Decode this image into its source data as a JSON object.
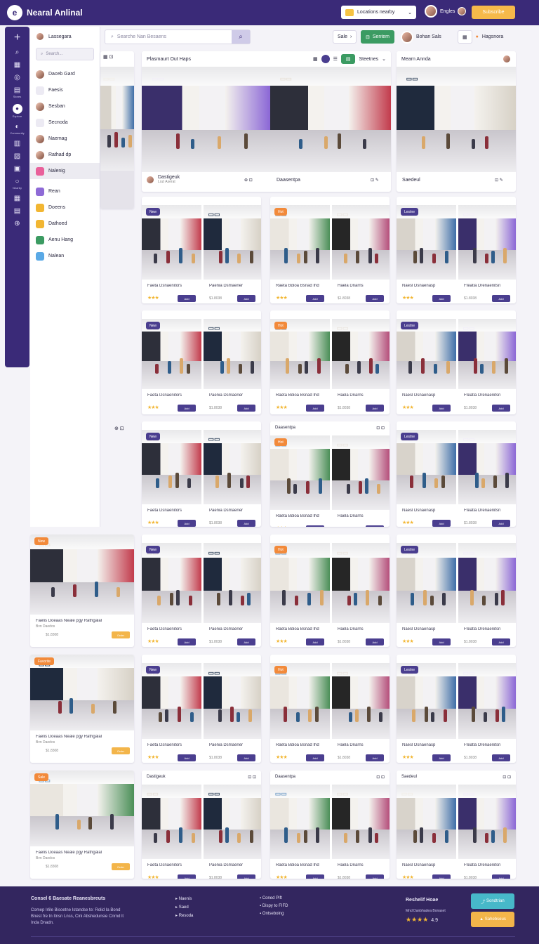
{
  "app": {
    "name": "Nearal Anlinal",
    "logo_glyph": "e"
  },
  "topbar": {
    "location_select": "Locations nearby",
    "user_name": "Engles",
    "cta_label": "Subscribe"
  },
  "rail": {
    "items": [
      {
        "icon": "plus-icon",
        "glyph": "+",
        "caption": ""
      },
      {
        "icon": "search-icon",
        "glyph": "⌕",
        "caption": ""
      },
      {
        "icon": "grid-icon",
        "glyph": "▦",
        "caption": ""
      },
      {
        "icon": "compass-icon",
        "glyph": "◎",
        "caption": ""
      },
      {
        "icon": "store-icon",
        "glyph": "▤",
        "caption": "Stores"
      },
      {
        "icon": "home-icon",
        "glyph": "●",
        "caption": "Explore",
        "active": true
      },
      {
        "icon": "map-icon",
        "glyph": "◐",
        "caption": "Community"
      },
      {
        "icon": "list-icon",
        "glyph": "▥",
        "caption": ""
      },
      {
        "icon": "layers-icon",
        "glyph": "▧",
        "caption": ""
      },
      {
        "icon": "image-icon",
        "glyph": "▣",
        "caption": ""
      },
      {
        "icon": "pin-icon",
        "glyph": "○",
        "caption": "Nearby"
      },
      {
        "icon": "calendar-icon",
        "glyph": "▦",
        "caption": ""
      },
      {
        "icon": "chat-icon",
        "glyph": "▤",
        "caption": ""
      },
      {
        "icon": "globe-icon",
        "glyph": "⊕",
        "caption": ""
      }
    ]
  },
  "sidemenu": {
    "user": "Lassegara",
    "search_placeholder": "Search...",
    "items": [
      {
        "label": "Daceb Gard",
        "kind": "person"
      },
      {
        "label": "Faesis",
        "kind": "plain"
      },
      {
        "label": "Sesban",
        "kind": "person"
      },
      {
        "label": "Secnoda",
        "kind": "plain"
      },
      {
        "label": "Naemag",
        "kind": "person"
      },
      {
        "label": "Rathad dp",
        "kind": "person"
      },
      {
        "label": "Nalenig",
        "kind": "pink",
        "active": true
      },
      {
        "label": "Rean",
        "kind": "purple"
      },
      {
        "label": "Doeens",
        "kind": "yellow"
      },
      {
        "label": "Dathoed",
        "kind": "yellow"
      },
      {
        "label": "Aenu Hang",
        "kind": "green"
      },
      {
        "label": "Nalean",
        "kind": "blue"
      }
    ]
  },
  "search": {
    "placeholder": "Searche Nan Besaens"
  },
  "controls": {
    "view_label": "Sale",
    "filter_label": "Sentem",
    "profile_label": "Bohan Sals",
    "sort_label": "Hagsnora"
  },
  "sections": {
    "s1": {
      "title": "Plasmaurt Out Haps",
      "sort": "Steetnes"
    },
    "s2": {
      "title": "Mearn Annda"
    }
  },
  "hero_captions": {
    "a": "Dastigeuk",
    "a_sub": "Lozi Aserat",
    "b": "Daasentpa",
    "c": "Saedeul"
  },
  "tiles": {
    "name_a": "Faeta Dsnaenitors",
    "name_b": "Paenia Dsmaener",
    "name_c": "Raeta Bdioa Bsnad Ihd",
    "name_d": "Haela Dnarns",
    "name_e": "Naesl Dsnaenasp",
    "name_f": "Fteatla Drenaenitsn",
    "price": "$1.8038",
    "price_b": "$1.8350",
    "btn": "Add"
  },
  "side_cards": {
    "title": "Faelis Doeaas Neale pgy Rathgalal",
    "sub": "Bvn Daedos",
    "price": "$1.8308",
    "btn": "Order"
  },
  "badges": {
    "new": "New",
    "sale": "Sale",
    "hot": "Hot",
    "deal": "Deal",
    "tag": "Lestne",
    "fav": "Favorite",
    "trend": "Trending"
  },
  "footer": {
    "about_title": "Consel 6 Baesate Reanesbreuts",
    "about_text": "Comep Irlile Bisoetne Istandse te: Rolid Ia Bond Bnest fre tn Itnsn Lnss, Cini Abshedunsie Cnrnd lt Inda Dnadn.",
    "col1": [
      "Naenis",
      "Saed",
      "Resoda"
    ],
    "col2": [
      "Coned Pift",
      "Dispy to FIFD",
      "Ontseboing"
    ],
    "reviews_title": "Reshelif Hoae",
    "reviews_sub": "Mnd Danbhadea Bonaset",
    "reviews_score": "4.9",
    "btn_primary": "Sondtrian",
    "btn_secondary": "Sahebseus"
  },
  "colors": {
    "primary": "#3a2a78",
    "accent": "#f6b94a",
    "green": "#3b9b62",
    "star": "#f2b632"
  }
}
